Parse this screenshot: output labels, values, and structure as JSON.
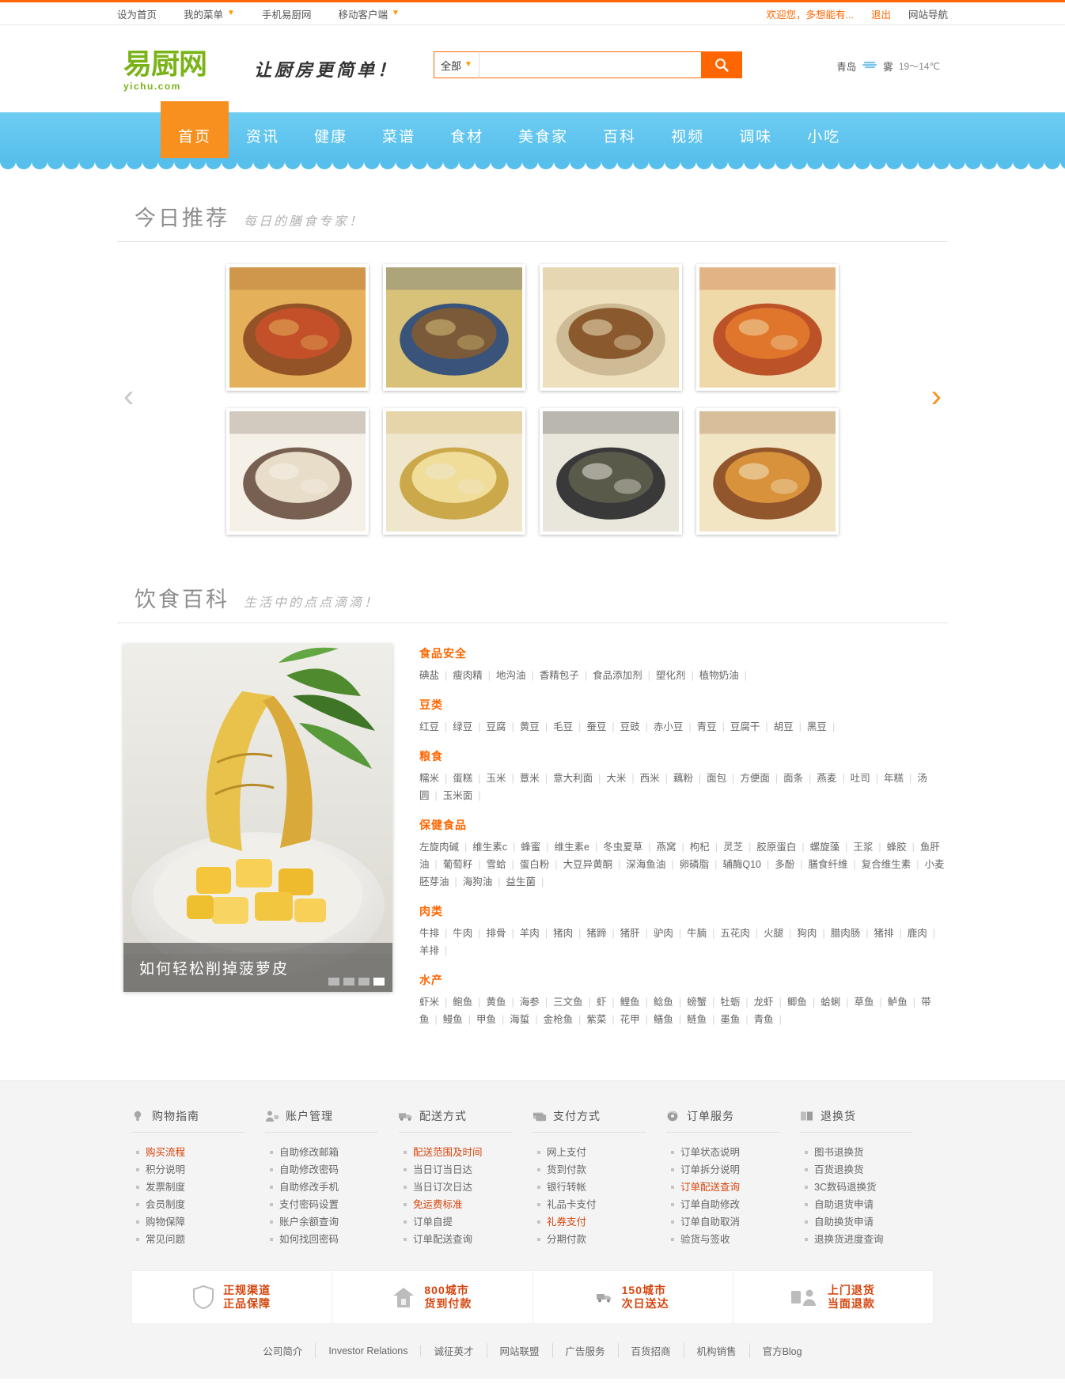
{
  "topbar": {
    "left": [
      {
        "label": "设为首页",
        "caret": false
      },
      {
        "label": "我的菜单",
        "caret": true
      },
      {
        "label": "手机易厨网",
        "caret": false
      },
      {
        "label": "移动客户端",
        "caret": true
      }
    ],
    "welcome": "欢迎您，多想能有...",
    "logout": "退出",
    "site_nav": "网站导航"
  },
  "header": {
    "logo_text": "易厨网",
    "logo_sub": "yichu.com",
    "slogan": "让厨房更简单！",
    "search": {
      "category": "全部",
      "value": "",
      "placeholder": "",
      "icon": "search-icon"
    },
    "weather": {
      "city": "青岛",
      "icon": "fog-icon",
      "condition": "雾",
      "temp": "19～14℃"
    }
  },
  "nav": {
    "items": [
      {
        "label": "首页",
        "active": true
      },
      {
        "label": "资讯",
        "active": false
      },
      {
        "label": "健康",
        "active": false
      },
      {
        "label": "菜谱",
        "active": false
      },
      {
        "label": "食材",
        "active": false
      },
      {
        "label": "美食家",
        "active": false
      },
      {
        "label": "百科",
        "active": false
      },
      {
        "label": "视频",
        "active": false
      },
      {
        "label": "调味",
        "active": false
      },
      {
        "label": "小吃",
        "active": false
      }
    ]
  },
  "recommend": {
    "title": "今日推荐",
    "subtitle": "每日的膳食专家！",
    "prev": "‹",
    "next": "›",
    "cards": [
      {
        "name": "braised-fish"
      },
      {
        "name": "stir-fry-bowl"
      },
      {
        "name": "stuffed-flatbread"
      },
      {
        "name": "roasted-shrimp"
      },
      {
        "name": "milk-tea-cup"
      },
      {
        "name": "egg-rolls"
      },
      {
        "name": "black-fungus-salad"
      },
      {
        "name": "grilled-skewers"
      }
    ]
  },
  "encyclopedia": {
    "title": "饮食百科",
    "subtitle": "生活中的点点滴滴！",
    "feature_caption": "如何轻松削掉菠萝皮",
    "dots": 4,
    "active_dot": 4,
    "categories": [
      {
        "title": "食品安全",
        "items": [
          "碘盐",
          "瘦肉精",
          "地沟油",
          "香精包子",
          "食品添加剂",
          "塑化剂",
          "植物奶油"
        ]
      },
      {
        "title": "豆类",
        "items": [
          "红豆",
          "绿豆",
          "豆腐",
          "黄豆",
          "毛豆",
          "蚕豆",
          "豆豉",
          "赤小豆",
          "青豆",
          "豆腐干",
          "胡豆",
          "黑豆"
        ]
      },
      {
        "title": "粮食",
        "items": [
          "糯米",
          "蛋糕",
          "玉米",
          "薏米",
          "意大利面",
          "大米",
          "西米",
          "藕粉",
          "面包",
          "方便面",
          "面条",
          "燕麦",
          "吐司",
          "年糕",
          "汤圆",
          "玉米面"
        ]
      },
      {
        "title": "保健食品",
        "items": [
          "左旋肉碱",
          "维生素c",
          "蜂蜜",
          "维生素e",
          "冬虫夏草",
          "燕窝",
          "枸杞",
          "灵芝",
          "胶原蛋白",
          "螺旋藻",
          "王浆",
          "蜂胶",
          "鱼肝油",
          "葡萄籽",
          "雪蛤",
          "蛋白粉",
          "大豆异黄酮",
          "深海鱼油",
          "卵磷脂",
          "辅酶Q10",
          "多酚",
          "膳食纤维",
          "复合维生素",
          "小麦胚芽油",
          "海狗油",
          "益生菌"
        ]
      },
      {
        "title": "肉类",
        "items": [
          "牛排",
          "牛肉",
          "排骨",
          "羊肉",
          "猪肉",
          "猪蹄",
          "猪肝",
          "驴肉",
          "牛腩",
          "五花肉",
          "火腿",
          "狗肉",
          "腊肉肠",
          "猪排",
          "鹿肉",
          "羊排"
        ]
      },
      {
        "title": "水产",
        "items": [
          "虾米",
          "鲍鱼",
          "黄鱼",
          "海参",
          "三文鱼",
          "虾",
          "鲤鱼",
          "鲶鱼",
          "螃蟹",
          "牡蛎",
          "龙虾",
          "鲫鱼",
          "蛤蜊",
          "草鱼",
          "鲈鱼",
          "带鱼",
          "鳗鱼",
          "甲鱼",
          "海蜇",
          "金枪鱼",
          "紫菜",
          "花甲",
          "鳝鱼",
          "鲢鱼",
          "墨鱼",
          "青鱼"
        ]
      }
    ]
  },
  "footer": {
    "columns": [
      {
        "icon": "bulb-icon",
        "title": "购物指南",
        "items": [
          {
            "label": "购买流程",
            "hot": true
          },
          {
            "label": "积分说明",
            "hot": false
          },
          {
            "label": "发票制度",
            "hot": false
          },
          {
            "label": "会员制度",
            "hot": false
          },
          {
            "label": "购物保障",
            "hot": false
          },
          {
            "label": "常见问题",
            "hot": false
          }
        ]
      },
      {
        "icon": "user-lock-icon",
        "title": "账户管理",
        "items": [
          {
            "label": "自助修改邮箱",
            "hot": false
          },
          {
            "label": "自助修改密码",
            "hot": false
          },
          {
            "label": "自助修改手机",
            "hot": false
          },
          {
            "label": "支付密码设置",
            "hot": false
          },
          {
            "label": "账户余额查询",
            "hot": false
          },
          {
            "label": "如何找回密码",
            "hot": false
          }
        ]
      },
      {
        "icon": "truck-icon",
        "title": "配送方式",
        "items": [
          {
            "label": "配送范围及时间",
            "hot": true
          },
          {
            "label": "当日订当日达",
            "hot": false
          },
          {
            "label": "当日订次日达",
            "hot": false
          },
          {
            "label": "免运费标准",
            "hot": true
          },
          {
            "label": "订单自提",
            "hot": false
          },
          {
            "label": "订单配送查询",
            "hot": false
          }
        ]
      },
      {
        "icon": "card-icon",
        "title": "支付方式",
        "items": [
          {
            "label": "网上支付",
            "hot": false
          },
          {
            "label": "货到付款",
            "hot": false
          },
          {
            "label": "银行转帐",
            "hot": false
          },
          {
            "label": "礼品卡支付",
            "hot": false
          },
          {
            "label": "礼券支付",
            "hot": true
          },
          {
            "label": "分期付款",
            "hot": false
          }
        ]
      },
      {
        "icon": "disc-icon",
        "title": "订单服务",
        "items": [
          {
            "label": "订单状态说明",
            "hot": false
          },
          {
            "label": "订单拆分说明",
            "hot": false
          },
          {
            "label": "订单配送查询",
            "hot": true
          },
          {
            "label": "订单自助修改",
            "hot": false
          },
          {
            "label": "订单自助取消",
            "hot": false
          },
          {
            "label": "验货与签收",
            "hot": false
          }
        ]
      },
      {
        "icon": "box-icon",
        "title": "退换货",
        "items": [
          {
            "label": "图书退换货",
            "hot": false
          },
          {
            "label": "百货退换货",
            "hot": false
          },
          {
            "label": "3C数码退换货",
            "hot": false
          },
          {
            "label": "自助退货申请",
            "hot": false
          },
          {
            "label": "自助换货申请",
            "hot": false
          },
          {
            "label": "退换货进度查询",
            "hot": false
          }
        ]
      }
    ],
    "badges": [
      {
        "icon": "shield-icon",
        "line1": "正规渠道",
        "line2": "正品保障"
      },
      {
        "icon": "house-icon",
        "line1": "800城市",
        "line2": "货到付款"
      },
      {
        "icon": "truck-icon",
        "line1": "150城市",
        "line2": "次日送达"
      },
      {
        "icon": "return-icon",
        "line1": "上门退货",
        "line2": "当面退款"
      }
    ],
    "links": [
      "公司简介",
      "Investor Relations",
      "诚征英才",
      "网站联盟",
      "广告服务",
      "百货招商",
      "机构销售",
      "官方Blog"
    ]
  },
  "colors": {
    "accent": "#f60",
    "nav_blue": "#57bfec",
    "active_orange": "#f7901e",
    "hot_red": "#d6450d",
    "logo_green": "#7ab317"
  }
}
